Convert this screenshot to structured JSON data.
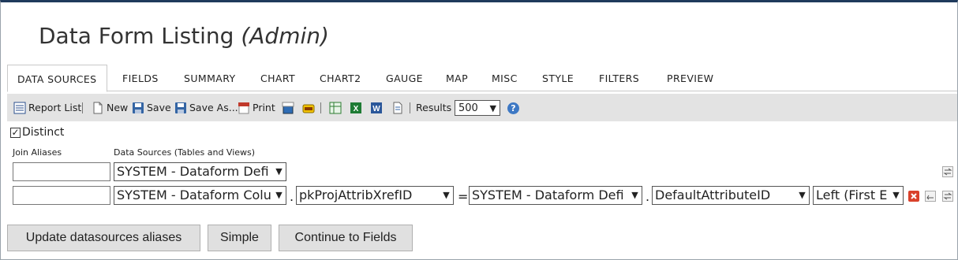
{
  "page": {
    "title": "Data Form Listing",
    "subtitle": "(Admin)"
  },
  "tabs": [
    "DATA SOURCES",
    "FIELDS",
    "SUMMARY",
    "CHART",
    "CHART2",
    "GAUGE",
    "MAP",
    "MISC",
    "STYLE",
    "FILTERS",
    "PREVIEW"
  ],
  "toolbar": {
    "report_list": "Report List",
    "new": "New",
    "save": "Save",
    "save_as": "Save As...",
    "print": "Print",
    "results_label": "Results",
    "results_value": "500",
    "help": "?"
  },
  "distinct": {
    "label": "Distinct",
    "checked": true
  },
  "headers": {
    "join_aliases": "Join Aliases",
    "data_sources": "Data Sources (Tables and Views)"
  },
  "rows": [
    {
      "alias": "",
      "source": "SYSTEM - Dataform Defi"
    },
    {
      "alias": "",
      "source": "SYSTEM - Dataform Colu",
      "field": "pkProjAttribXrefID",
      "operator": "=",
      "target": "SYSTEM - Dataform Defi",
      "target_field": "DefaultAttributeID",
      "join": "Left (First E"
    }
  ],
  "buttons": {
    "update": "Update datasources aliases",
    "simple": "Simple",
    "continue": "Continue to Fields"
  },
  "colors": {
    "toolbar_bg": "#e3e3e3",
    "button_bg": "#e0e0e0",
    "help_blue": "#3d78c4",
    "delete_red": "#d9412b"
  }
}
